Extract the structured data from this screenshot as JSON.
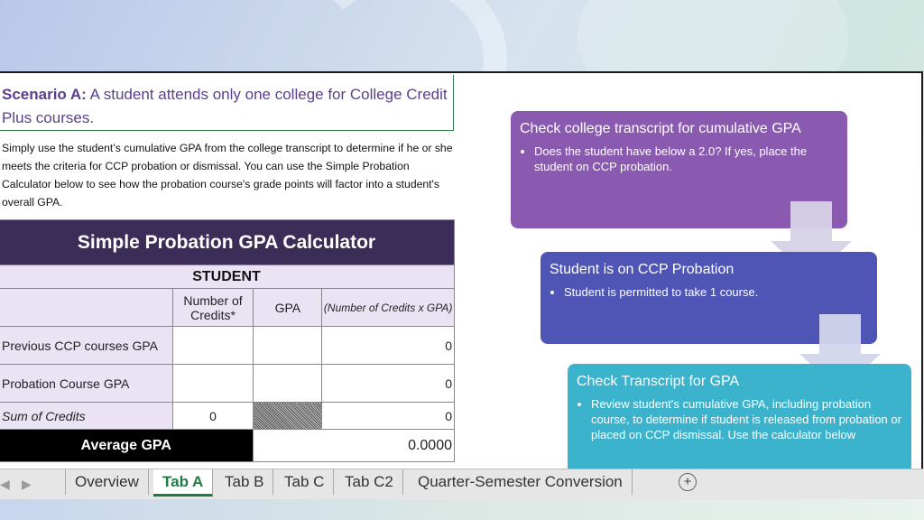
{
  "scenario": {
    "label": "Scenario A:",
    "text": " A student attends only one college for College Credit Plus courses."
  },
  "description": "Simply use the student’s cumulative GPA from the college transcript to determine if he or she meets the criteria for CCP probation or dismissal.  You can use the Simple Probation Calculator below to see how the probation course's grade points will factor into a student's overall GPA.",
  "calculator": {
    "title": "Simple Probation GPA Calculator",
    "section": "STUDENT",
    "headers": [
      "Number of Credits*",
      "GPA",
      "(Number of Credits x GPA)"
    ],
    "rows": [
      {
        "label": "Previous CCP courses GPA",
        "credits": "",
        "gpa": "",
        "product": "0"
      },
      {
        "label": "Probation Course GPA",
        "credits": "",
        "gpa": "",
        "product": "0"
      }
    ],
    "sum": {
      "label": "Sum of Credits",
      "credits": "0",
      "product": "0"
    },
    "average": {
      "label": "Average GPA",
      "value": "0.0000"
    }
  },
  "flow": [
    {
      "heading": "Check college transcript for cumulative GPA",
      "bullet": "Does the student have below a 2.0? If yes, place the student on CCP probation.",
      "color": "#8a5ab0"
    },
    {
      "heading": "Student is on CCP Probation",
      "bullet": "Student is permitted to take 1 course.",
      "color": "#4e55b5"
    },
    {
      "heading": "Check Transcript for GPA",
      "bullet": "Review student's cumulative GPA, including probation course, to determine if student is released from probation or placed on CCP dismissal. Use the calculator below",
      "color": "#3cb3cc"
    }
  ],
  "tabs": {
    "items": [
      "Overview",
      "Tab A",
      "Tab B",
      "Tab C",
      "Tab C2",
      "Quarter-Semester Conversion"
    ],
    "active": "Tab A",
    "accent": "#1f7a45"
  }
}
